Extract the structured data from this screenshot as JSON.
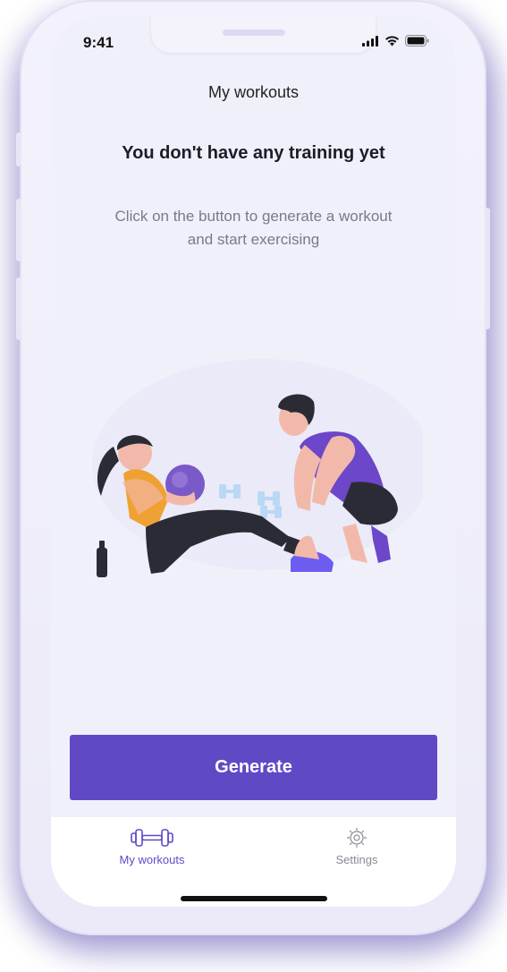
{
  "status_bar": {
    "time": "9:41",
    "icons": [
      "cellular-signal-icon",
      "wifi-icon",
      "battery-icon"
    ]
  },
  "header": {
    "title": "My workouts"
  },
  "empty_state": {
    "headline": "You don't have any training yet",
    "description": "Click on the button to generate a workout and start exercising",
    "illustration": "trainer-and-woman-doing-situps-illustration"
  },
  "actions": {
    "generate_label": "Generate"
  },
  "tab_bar": {
    "items": [
      {
        "label": "My workouts",
        "icon": "dumbbell-icon",
        "active": true
      },
      {
        "label": "Settings",
        "icon": "settings-gear-icon",
        "active": false
      }
    ]
  },
  "colors": {
    "accent": "#6149c6",
    "background": "#f0f0fb",
    "text_primary": "#1d1d28",
    "text_secondary": "#7a7a88",
    "tab_inactive": "#8a8a96"
  }
}
